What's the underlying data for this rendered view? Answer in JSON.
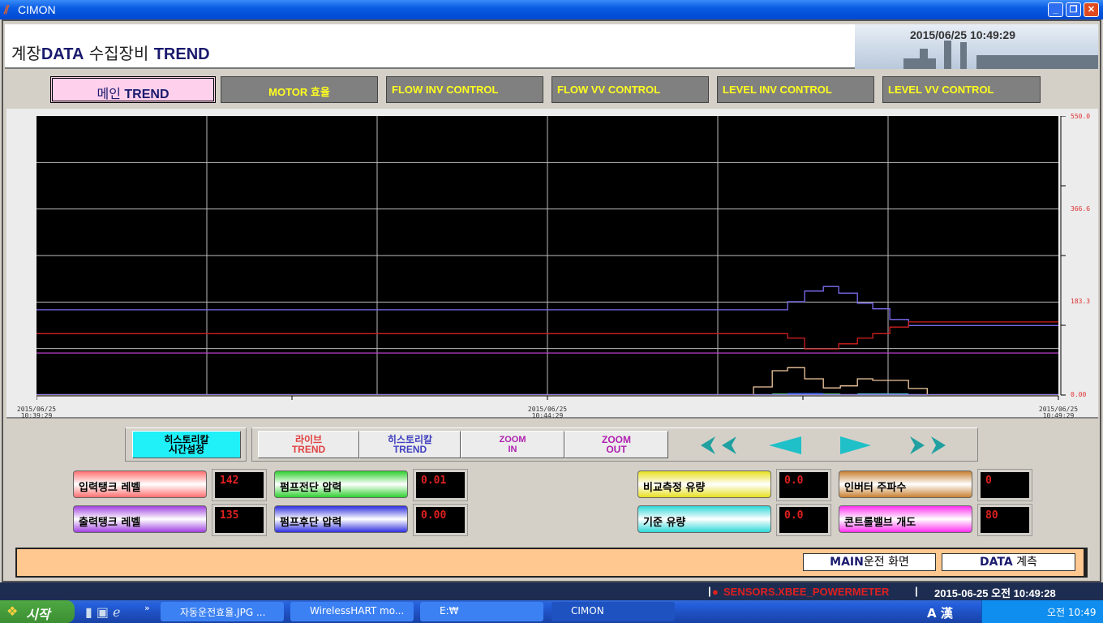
{
  "window": {
    "title": "CIMON",
    "minimize": "_",
    "restore": "❐",
    "close": "✕"
  },
  "header": {
    "title_a": "계장",
    "title_b": "DATA",
    "title_c": " 수집장비 ",
    "title_d": "TREND",
    "datetime": "2015/06/25 10:49:29"
  },
  "tabs": [
    {
      "label_a": "메인 ",
      "label_b": "TREND"
    },
    {
      "label": "MOTOR 효율"
    },
    {
      "label": "FLOW INV CONTROL"
    },
    {
      "label": "FLOW VV CONTROL"
    },
    {
      "label": "LEVEL INV CONTROL"
    },
    {
      "label": "LEVEL VV CONTROL"
    }
  ],
  "chart_data": {
    "type": "line",
    "ylim": [
      0,
      550
    ],
    "ytick_labels": [
      "550.0",
      "366.6",
      "183.3",
      "0.00"
    ],
    "xlim": [
      "10:39:29",
      "10:49:29"
    ],
    "xtick_labels": [
      {
        "date": "2015/06/25",
        "time": "10:39:29"
      },
      {
        "date": "2015/06/25",
        "time": "10:44:29"
      },
      {
        "date": "2015/06/25",
        "time": "10:49:29"
      }
    ],
    "grid": true,
    "background": "#000000",
    "series": [
      {
        "color": "#7b6cf0",
        "points": [
          [
            "10:39:29",
            168
          ],
          [
            "10:46:50",
            168
          ],
          [
            "10:46:50",
            184
          ],
          [
            "10:47:00",
            184
          ],
          [
            "10:47:00",
            205
          ],
          [
            "10:47:11",
            205
          ],
          [
            "10:47:11",
            214
          ],
          [
            "10:47:20",
            214
          ],
          [
            "10:47:20",
            201
          ],
          [
            "10:47:31",
            201
          ],
          [
            "10:47:31",
            181
          ],
          [
            "10:47:40",
            181
          ],
          [
            "10:47:40",
            170
          ],
          [
            "10:47:50",
            170
          ],
          [
            "10:47:50",
            149
          ],
          [
            "10:48:01",
            149
          ],
          [
            "10:48:01",
            137
          ],
          [
            "10:49:29",
            137
          ]
        ]
      },
      {
        "color": "#d02020",
        "points": [
          [
            "10:39:29",
            121
          ],
          [
            "10:46:50",
            121
          ],
          [
            "10:46:50",
            112
          ],
          [
            "10:47:00",
            112
          ],
          [
            "10:47:00",
            91
          ],
          [
            "10:47:20",
            91
          ],
          [
            "10:47:20",
            101
          ],
          [
            "10:47:31",
            101
          ],
          [
            "10:47:31",
            112
          ],
          [
            "10:47:40",
            112
          ],
          [
            "10:47:40",
            121
          ],
          [
            "10:47:50",
            121
          ],
          [
            "10:47:50",
            134
          ],
          [
            "10:48:01",
            134
          ],
          [
            "10:48:01",
            144
          ],
          [
            "10:49:29",
            144
          ]
        ]
      },
      {
        "color": "#c040d0",
        "points": [
          [
            "10:39:29",
            83
          ],
          [
            "10:49:29",
            83
          ]
        ]
      },
      {
        "color": "#f0c8a0",
        "points": [
          [
            "10:39:29",
            0
          ],
          [
            "10:46:30",
            0
          ],
          [
            "10:46:30",
            16
          ],
          [
            "10:46:41",
            16
          ],
          [
            "10:46:41",
            48
          ],
          [
            "10:46:50",
            48
          ],
          [
            "10:46:50",
            54
          ],
          [
            "10:47:00",
            54
          ],
          [
            "10:47:00",
            32
          ],
          [
            "10:47:11",
            32
          ],
          [
            "10:47:11",
            14
          ],
          [
            "10:47:21",
            14
          ],
          [
            "10:47:21",
            18
          ],
          [
            "10:47:31",
            18
          ],
          [
            "10:47:31",
            32
          ],
          [
            "10:47:40",
            32
          ],
          [
            "10:47:40",
            29
          ],
          [
            "10:48:01",
            29
          ],
          [
            "10:48:01",
            13
          ],
          [
            "10:48:12",
            13
          ],
          [
            "10:48:12",
            0
          ],
          [
            "10:49:29",
            0
          ]
        ]
      },
      {
        "color": "#40d060",
        "points": [
          [
            "10:46:41",
            2
          ],
          [
            "10:47:21",
            2
          ]
        ]
      },
      {
        "color": "#3060ff",
        "points": [
          [
            "10:46:50",
            3
          ],
          [
            "10:47:11",
            3
          ]
        ]
      },
      {
        "color": "#40d0e0",
        "points": [
          [
            "10:47:31",
            2
          ],
          [
            "10:48:01",
            2
          ]
        ]
      },
      {
        "color": "#9080e0",
        "points": [
          [
            "10:39:29",
            1
          ],
          [
            "10:49:29",
            1
          ]
        ]
      }
    ]
  },
  "controls": {
    "hist_time_a": "히스토리칼",
    "hist_time_b": "시간설정",
    "live_a": "라이브",
    "live_b": "TREND",
    "hist_a": "히스토리칼",
    "hist_b": "TREND",
    "zoom_in_a": "ZOOM",
    "zoom_in_b": "IN",
    "zoom_out_a": "ZOOM",
    "zoom_out_b": "OUT"
  },
  "sensors": [
    {
      "label": "입력탱크 레벨",
      "value": "142",
      "color": "#ff7070"
    },
    {
      "label": "출력탱크 레벨",
      "value": "135",
      "color": "#a040e0"
    },
    {
      "label": "펌프전단 압력",
      "value": "0.01",
      "color": "#30d030"
    },
    {
      "label": "펌프후단 압력",
      "value": "0.00",
      "color": "#3030e0"
    },
    {
      "label": "비교측정 유량",
      "value": "0.0",
      "color": "#e8e020"
    },
    {
      "label": "기준 유량",
      "value": "0.0",
      "color": "#30d8d8"
    },
    {
      "label": "인버터 주파수",
      "value": "0",
      "color": "#c88030"
    },
    {
      "label": "콘트롤밸브 개도",
      "value": "80",
      "color": "#ff30f0"
    }
  ],
  "footer": {
    "main_a": "MAIN",
    "main_b": "운전 화면",
    "data_a": "DATA",
    "data_b": " 계측"
  },
  "status": {
    "tag": "SENSORS.XBEE_POWERMETER",
    "sep": "|",
    "datetime": "2015-06-25 오전 10:49:28"
  },
  "taskbar": {
    "start": "시작",
    "more": "»",
    "tasks": [
      "자동운전효율.JPG ...",
      "WirelessHART mo...",
      "E:₩",
      "CIMON"
    ],
    "ime": "A 漢",
    "clock": "오전 10:49"
  }
}
